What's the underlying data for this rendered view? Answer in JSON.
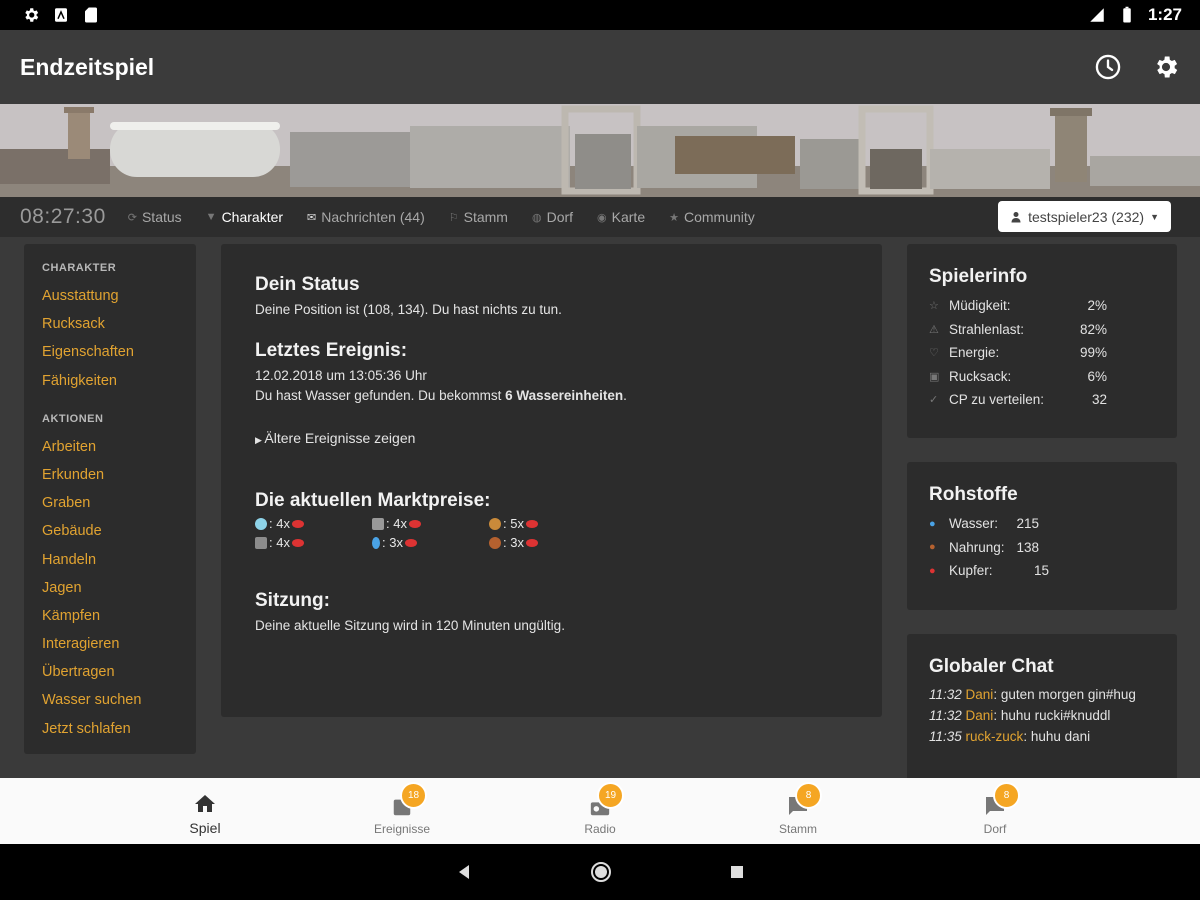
{
  "status_bar": {
    "time": "1:27"
  },
  "app_bar": {
    "title": "Endzeitspiel",
    "history_icon": "history-icon",
    "settings_icon": "gear-icon"
  },
  "nav": {
    "time": "08:27:30",
    "items": [
      {
        "label": "Status",
        "icon": "refresh-icon"
      },
      {
        "label": "Charakter",
        "icon": "shirt-icon"
      },
      {
        "label": "Nachrichten (44)",
        "icon": "envelope-icon"
      },
      {
        "label": "Stamm",
        "icon": "group-icon"
      },
      {
        "label": "Dorf",
        "icon": "globe-icon"
      },
      {
        "label": "Karte",
        "icon": "map-marker-icon"
      },
      {
        "label": "Community",
        "icon": "star-icon"
      }
    ],
    "user": "testspieler23 (232)"
  },
  "left_nav": {
    "section1": "CHARAKTER",
    "char_links": [
      "Ausstattung",
      "Rucksack",
      "Eigenschaften",
      "Fähigkeiten"
    ],
    "section2": "AKTIONEN",
    "action_links": [
      "Arbeiten",
      "Erkunden",
      "Graben",
      "Gebäude",
      "Handeln",
      "Jagen",
      "Kämpfen",
      "Interagieren",
      "Übertragen",
      "Wasser suchen",
      "Jetzt schlafen"
    ]
  },
  "main": {
    "status_title": "Dein Status",
    "status_text": "Deine Position ist (108, 134). Du hast nichts zu tun.",
    "event_title": "Letztes Ereignis:",
    "event_date": "12.02.2018 um 13:05:36 Uhr",
    "event_text_pre": "Du hast Wasser gefunden. Du bekommst ",
    "event_text_bold": "6 Wassereinheiten",
    "event_text_post": ".",
    "older_events": "Ältere Ereignisse zeigen",
    "market_title": "Die aktuellen Marktpreise:",
    "prices": [
      {
        "icon": "gem-icon",
        "value": ": 4x"
      },
      {
        "icon": "metal-icon",
        "value": ": 4x"
      },
      {
        "icon": "bread-icon",
        "value": ": 5x"
      },
      {
        "icon": "stone-icon",
        "value": ": 4x"
      },
      {
        "icon": "water-icon",
        "value": ": 3x"
      },
      {
        "icon": "meat-icon",
        "value": ": 3x"
      }
    ],
    "session_title": "Sitzung:",
    "session_text": "Deine aktuelle Sitzung wird in 120 Minuten ungültig."
  },
  "spielerinfo": {
    "title": "Spielerinfo",
    "rows": [
      {
        "label": "Müdigkeit:",
        "value": "2%"
      },
      {
        "label": "Strahlenlast:",
        "value": "82%"
      },
      {
        "label": "Energie:",
        "value": "99%"
      },
      {
        "label": "Rucksack:",
        "value": "6%"
      },
      {
        "label": "CP zu verteilen:",
        "value": "32"
      }
    ]
  },
  "rohstoffe": {
    "title": "Rohstoffe",
    "rows": [
      {
        "label": "Wasser:",
        "value": "215"
      },
      {
        "label": "Nahrung:",
        "value": "138"
      },
      {
        "label": "Kupfer:",
        "value": "15"
      }
    ]
  },
  "chat": {
    "title": "Globaler Chat",
    "lines": [
      {
        "time": "11:32",
        "user": "Dani",
        "text": ": guten morgen gin#hug"
      },
      {
        "time": "11:32",
        "user": "Dani",
        "text": ": huhu rucki#knuddl"
      },
      {
        "time": "11:35",
        "user": "ruck-zuck",
        "text": ": huhu dani"
      }
    ]
  },
  "bottom_nav": {
    "items": [
      {
        "label": "Spiel",
        "badge": ""
      },
      {
        "label": "Ereignisse",
        "badge": "18"
      },
      {
        "label": "Radio",
        "badge": "19"
      },
      {
        "label": "Stamm",
        "badge": "8"
      },
      {
        "label": "Dorf",
        "badge": "8"
      }
    ]
  },
  "colors": {
    "accent": "#e1a331",
    "badge": "#f5a623",
    "panel": "#2c2c2c",
    "background": "#3a3a3a"
  }
}
